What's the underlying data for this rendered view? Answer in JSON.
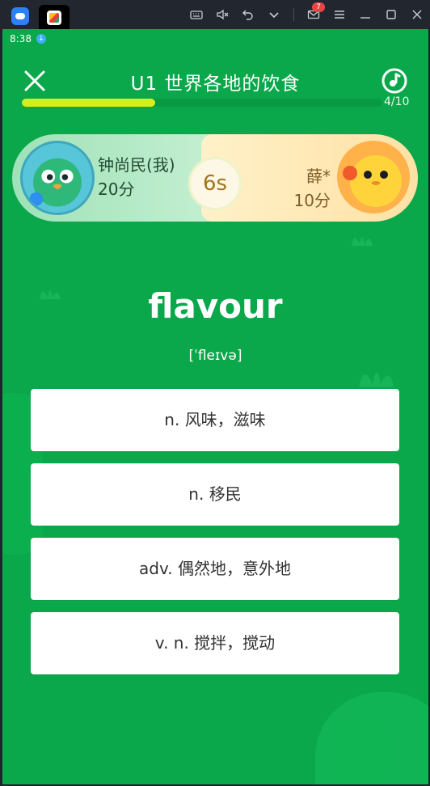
{
  "emulator": {
    "notification_count": "7",
    "icons": [
      "keyboard-icon",
      "mute-icon",
      "undo-icon",
      "chevron-down-icon",
      "mail-icon",
      "menu-icon",
      "minimize-icon",
      "maximize-icon",
      "close-icon"
    ]
  },
  "status_bar": {
    "time": "8:38"
  },
  "header": {
    "title": "U1 世界各地的饮食",
    "progress_text": "4/10",
    "progress_fraction": 0.37
  },
  "battle": {
    "player": {
      "name": "钟尚民(我)",
      "score": "20分"
    },
    "timer": "6s",
    "opponent": {
      "name": "薛*",
      "score": "10分"
    }
  },
  "question": {
    "word": "flavour",
    "phonetic": "[ˈfleɪvə]"
  },
  "options": [
    "n. 风味，滋味",
    "n. 移民",
    "adv. 偶然地，意外地",
    "v. n. 搅拌，搅动"
  ],
  "colors": {
    "background": "#0aa84a",
    "progress_fill": "#d8ee19",
    "timer_text": "#a3741e"
  }
}
